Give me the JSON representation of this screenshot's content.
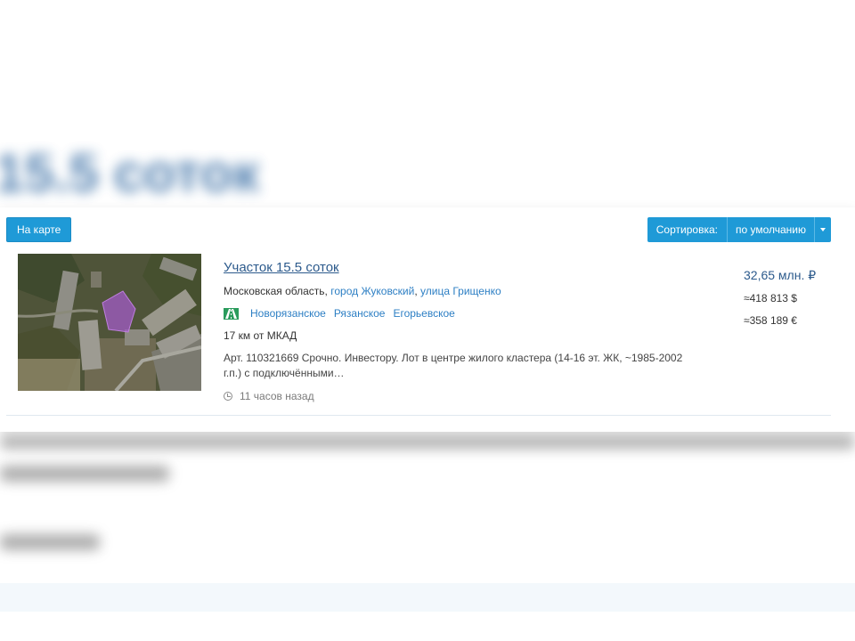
{
  "background": {
    "heading": "15.5 соток"
  },
  "toolbar": {
    "map_button": "На карте",
    "sort_label": "Сортировка:",
    "sort_value": "по умолчанию",
    "caret_icon": "caret-down-icon"
  },
  "listing": {
    "title": "Участок 15.5 соток",
    "address_region": "Московская область,",
    "address_city": "город Жуковский",
    "address_sep": ",",
    "address_street": "улица Грищенко",
    "highway_icon": "highway-icon",
    "highways": [
      "Новорязанское",
      "Рязанское",
      "Егорьевское"
    ],
    "distance": "17 км от МКАД",
    "description": "Арт. 110321669 Срочно. Инвестору. Лот в центре жилого кластера (14-16 эт. ЖК, ~1985-2002 г.п.) с подключёнными…",
    "time_icon": "clock-icon",
    "time": "11 часов назад",
    "price_main": "32,65 млн. ₽",
    "price_usd": "≈418 813 $",
    "price_eur": "≈358 189 €"
  },
  "colors": {
    "accent": "#1f9ad7",
    "link": "#2d7fc4",
    "title": "#2c5a8c"
  }
}
